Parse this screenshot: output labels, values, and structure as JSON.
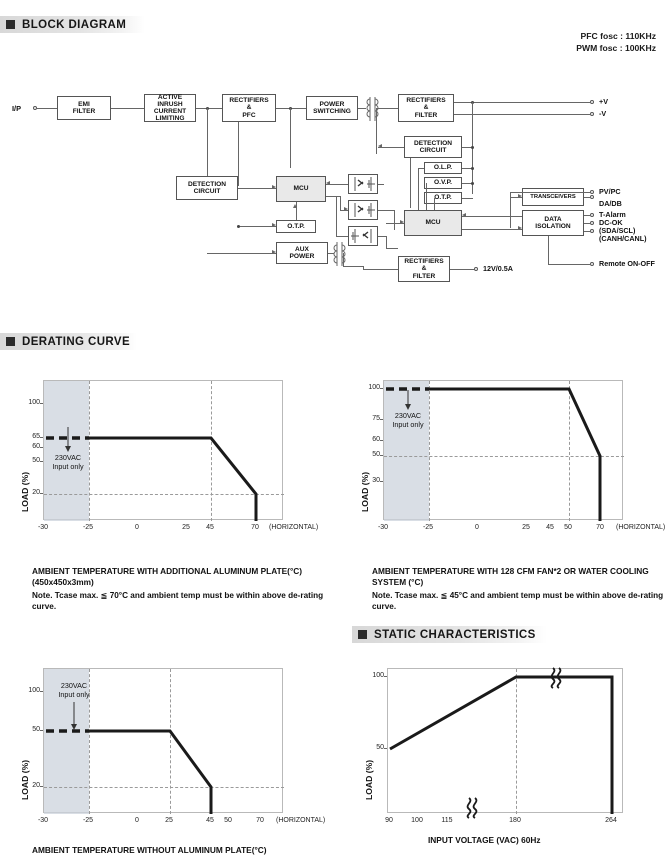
{
  "sections": {
    "block_diagram": "BLOCK DIAGRAM",
    "derating_curve": "DERATING CURVE",
    "static_characteristics": "STATIC CHARACTERISTICS"
  },
  "block_diagram": {
    "fosc": [
      "PFC fosc : 110KHz",
      "PWM fosc : 100KHz"
    ],
    "input_label": "I/P",
    "blocks": {
      "emi_filter": "EMI\nFILTER",
      "active_inrush": "ACTIVE\nINRUSH\nCURRENT\nLIMITING",
      "rectifiers_pfc": "RECTIFIERS\n&\nPFC",
      "power_switching": "POWER\nSWITCHING",
      "rectifiers_filter_out": "RECTIFIERS\n&\nFILTER",
      "detection_circuit_in": "DETECTION\nCIRCUIT",
      "detection_circuit_out": "DETECTION\nCIRCUIT",
      "mcu_primary": "MCU",
      "mcu_secondary": "MCU",
      "otp_primary": "O.T.P.",
      "aux_power": "AUX\nPOWER",
      "olp": "O.L.P.",
      "ovp": "O.V.P.",
      "otp_secondary": "O.T.P.",
      "transceivers": "TRANSCEIVERS",
      "data_isolation": "DATA\nISOLATION",
      "rectifiers_filter_aux": "RECTIFIERS\n&\nFILTER"
    },
    "outputs": {
      "pos_v": "+V",
      "neg_v": "-V",
      "pvpc": "PV/PC",
      "dadb": "DA/DB",
      "talarm": "T-Alarm",
      "dcok": "DC-OK",
      "sda_scl": "(SDA/SCL)\n(CANH/CANL)",
      "remote": "Remote ON-OFF",
      "aux_12v": "12V/0.5A"
    }
  },
  "chart_data": [
    {
      "id": "derating-aluminum-plate",
      "type": "line",
      "title": "AMBIENT TEMPERATURE WITH ADDITIONAL ALUMINUM PLATE(°C)",
      "subtitle": "(450x450x3mm)",
      "note": "Note. Tcase max. ≦ 70°C and ambient temp must be within above de-rating curve.",
      "xlabel": "(HORIZONTAL)",
      "ylabel": "LOAD (%)",
      "xlim": [
        -30,
        78
      ],
      "ylim": [
        0,
        110
      ],
      "xticks": [
        -30,
        -25,
        0,
        25,
        45,
        70
      ],
      "yticks": [
        100,
        65,
        60,
        50,
        20
      ],
      "grid": true,
      "shaded_region": {
        "label": "230VAC\nInput only",
        "x_from": -30,
        "x_to": -25
      },
      "dashed_segment": {
        "x": [
          -30,
          -25
        ],
        "y": [
          65,
          65
        ]
      },
      "x": [
        -25,
        45,
        70,
        70
      ],
      "y": [
        65,
        65,
        20,
        0
      ],
      "gridlines_v": [
        -25,
        45
      ],
      "gridlines_h": [
        20
      ]
    },
    {
      "id": "derating-fan-water-cooling",
      "type": "line",
      "title": "AMBIENT TEMPERATURE WITH 128 CFM FAN*2 OR WATER COOLING SYSTEM (°C)",
      "subtitle": "",
      "note": "Note. Tcase max. ≦ 45°C and ambient temp must be within above de-rating curve.",
      "xlabel": "(HORIZONTAL)",
      "ylabel": "LOAD (%)",
      "xlim": [
        -30,
        78
      ],
      "ylim": [
        0,
        110
      ],
      "xticks": [
        -30,
        -25,
        0,
        25,
        45,
        50,
        70
      ],
      "yticks": [
        100,
        75,
        60,
        50,
        30
      ],
      "grid": true,
      "shaded_region": {
        "label": "230VAC\nInput only",
        "x_from": -30,
        "x_to": -25
      },
      "dashed_segment": {
        "x": [
          -30,
          -25
        ],
        "y": [
          100,
          100
        ]
      },
      "x": [
        -25,
        50,
        68,
        68
      ],
      "y": [
        100,
        100,
        50,
        0
      ],
      "gridlines_v": [
        -25,
        50
      ],
      "gridlines_h": [
        50
      ]
    },
    {
      "id": "derating-without-aluminum-plate",
      "type": "line",
      "title": "AMBIENT TEMPERATURE WITHOUT ALUMINUM PLATE(°C)",
      "subtitle": "",
      "note": "",
      "xlabel": "(HORIZONTAL)",
      "ylabel": "LOAD (%)",
      "xlim": [
        -30,
        78
      ],
      "ylim": [
        0,
        110
      ],
      "xticks": [
        -30,
        -25,
        0,
        25,
        45,
        50,
        70
      ],
      "yticks": [
        100,
        50,
        20
      ],
      "grid": true,
      "shaded_region": {
        "label": "230VAC\nInput only",
        "x_from": -30,
        "x_to": -25
      },
      "dashed_segment": {
        "x": [
          -30,
          -25
        ],
        "y": [
          50,
          50
        ]
      },
      "x": [
        -25,
        25,
        50,
        50
      ],
      "y": [
        50,
        50,
        20,
        0
      ],
      "gridlines_v": [
        -25,
        25
      ],
      "gridlines_h": [
        20
      ]
    },
    {
      "id": "static-characteristics",
      "type": "line",
      "title": "INPUT VOLTAGE (VAC) 60Hz",
      "subtitle": "",
      "note": "",
      "xlabel": "INPUT VOLTAGE (VAC) 60Hz",
      "ylabel": "LOAD (%)",
      "xlim": [
        90,
        275
      ],
      "ylim": [
        0,
        110
      ],
      "xticks": [
        90,
        100,
        115,
        180,
        264
      ],
      "yticks": [
        100,
        50
      ],
      "grid": true,
      "break_marks": [
        "x-axis between 115 and 180",
        "top of curve between 180 and 264"
      ],
      "x": [
        90,
        180,
        264,
        264
      ],
      "y": [
        50,
        100,
        100,
        0
      ],
      "gridlines_v": [
        180
      ],
      "gridlines_h": []
    }
  ]
}
